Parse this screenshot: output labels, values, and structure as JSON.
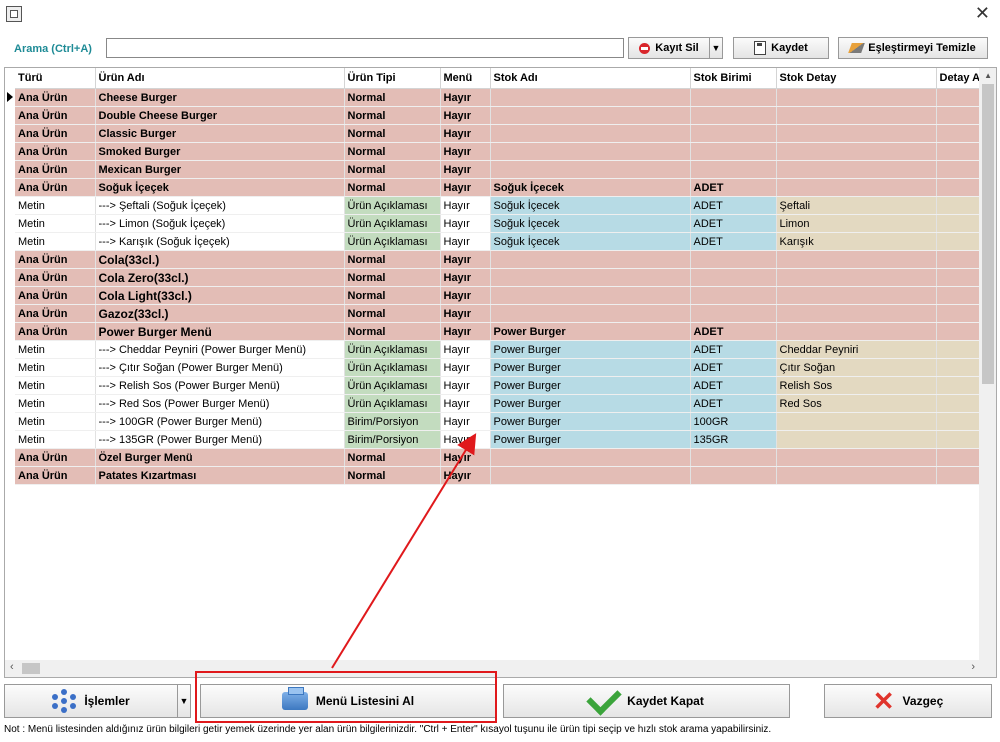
{
  "window": {
    "close_glyph": "✕"
  },
  "search": {
    "label": "Arama (Ctrl+A)",
    "value": "",
    "placeholder": ""
  },
  "toolbar": {
    "delete_label": "Kayıt Sil",
    "save_label": "Kaydet",
    "clear_label": "Eşleştirmeyi Temizle"
  },
  "grid": {
    "columns": [
      "Türü",
      "Ürün Adı",
      "Ürün Tipi",
      "Menü",
      "Stok Adı",
      "Stok Birimi",
      "Stok Detay",
      "Detay A"
    ],
    "rows": [
      {
        "kind": "ana",
        "turu": "Ana Ürün",
        "urun": "Cheese Burger",
        "tip": "Normal",
        "menu": "Hayır",
        "stok": "",
        "birim": "",
        "detay": ""
      },
      {
        "kind": "ana",
        "turu": "Ana Ürün",
        "urun": "Double Cheese Burger",
        "tip": "Normal",
        "menu": "Hayır",
        "stok": "",
        "birim": "",
        "detay": ""
      },
      {
        "kind": "ana",
        "turu": "Ana Ürün",
        "urun": "Classic Burger",
        "tip": "Normal",
        "menu": "Hayır",
        "stok": "",
        "birim": "",
        "detay": ""
      },
      {
        "kind": "ana",
        "turu": "Ana Ürün",
        "urun": "Smoked Burger",
        "tip": "Normal",
        "menu": "Hayır",
        "stok": "",
        "birim": "",
        "detay": ""
      },
      {
        "kind": "ana",
        "turu": "Ana Ürün",
        "urun": "Mexican Burger",
        "tip": "Normal",
        "menu": "Hayır",
        "stok": "",
        "birim": "",
        "detay": ""
      },
      {
        "kind": "ana",
        "turu": "Ana Ürün",
        "urun": "Soğuk İçeçek",
        "tip": "Normal",
        "menu": "Hayır",
        "stok": "Soğuk İçecek",
        "birim": "ADET",
        "detay": ""
      },
      {
        "kind": "metin",
        "turu": "Metin",
        "urun": "---> Şeftali (Soğuk İçeçek)",
        "tip": "Ürün Açıklaması",
        "menu": "Hayır",
        "stok": "Soğuk İçecek",
        "birim": "ADET",
        "detay": "Şeftali"
      },
      {
        "kind": "metin",
        "turu": "Metin",
        "urun": "---> Limon (Soğuk İçeçek)",
        "tip": "Ürün Açıklaması",
        "menu": "Hayır",
        "stok": "Soğuk İçecek",
        "birim": "ADET",
        "detay": "Limon"
      },
      {
        "kind": "metin",
        "turu": "Metin",
        "urun": "---> Karışık (Soğuk İçeçek)",
        "tip": "Ürün Açıklaması",
        "menu": "Hayır",
        "stok": "Soğuk İçecek",
        "birim": "ADET",
        "detay": "Karışık"
      },
      {
        "kind": "ana",
        "big": true,
        "turu": "Ana Ürün",
        "urun": "Cola(33cl.)",
        "tip": "Normal",
        "menu": "Hayır",
        "stok": "",
        "birim": "",
        "detay": ""
      },
      {
        "kind": "ana",
        "big": true,
        "turu": "Ana Ürün",
        "urun": "Cola Zero(33cl.)",
        "tip": "Normal",
        "menu": "Hayır",
        "stok": "",
        "birim": "",
        "detay": ""
      },
      {
        "kind": "ana",
        "big": true,
        "turu": "Ana Ürün",
        "urun": "Cola Light(33cl.)",
        "tip": "Normal",
        "menu": "Hayır",
        "stok": "",
        "birim": "",
        "detay": ""
      },
      {
        "kind": "ana",
        "big": true,
        "turu": "Ana Ürün",
        "urun": "Gazoz(33cl.)",
        "tip": "Normal",
        "menu": "Hayır",
        "stok": "",
        "birim": "",
        "detay": ""
      },
      {
        "kind": "ana",
        "big": true,
        "turu": "Ana Ürün",
        "urun": "Power Burger Menü",
        "tip": "Normal",
        "menu": "Hayır",
        "stok": "Power Burger",
        "birim": "ADET",
        "detay": ""
      },
      {
        "kind": "metin",
        "turu": "Metin",
        "urun": "---> Cheddar Peyniri (Power Burger Menü)",
        "tip": "Ürün Açıklaması",
        "menu": "Hayır",
        "stok": "Power Burger",
        "birim": "ADET",
        "detay": "Cheddar Peyniri"
      },
      {
        "kind": "metin",
        "turu": "Metin",
        "urun": "---> Çıtır Soğan (Power Burger Menü)",
        "tip": "Ürün Açıklaması",
        "menu": "Hayır",
        "stok": "Power Burger",
        "birim": "ADET",
        "detay": "Çıtır Soğan"
      },
      {
        "kind": "metin",
        "turu": "Metin",
        "urun": "---> Relish Sos (Power Burger Menü)",
        "tip": "Ürün Açıklaması",
        "menu": "Hayır",
        "stok": "Power Burger",
        "birim": "ADET",
        "detay": "Relish Sos"
      },
      {
        "kind": "metin",
        "turu": "Metin",
        "urun": "---> Red Sos (Power Burger Menü)",
        "tip": "Ürün Açıklaması",
        "menu": "Hayır",
        "stok": "Power Burger",
        "birim": "ADET",
        "detay": "Red Sos"
      },
      {
        "kind": "metin",
        "turu": "Metin",
        "urun": "---> 100GR (Power Burger Menü)",
        "tip": "Birim/Porsiyon",
        "menu": "Hayır",
        "stok": "Power Burger",
        "birim": "100GR",
        "detay": ""
      },
      {
        "kind": "metin",
        "turu": "Metin",
        "urun": "---> 135GR (Power Burger Menü)",
        "tip": "Birim/Porsiyon",
        "menu": "Hayır",
        "stok": "Power Burger",
        "birim": "135GR",
        "detay": ""
      },
      {
        "kind": "ana",
        "turu": "Ana Ürün",
        "urun": "Özel Burger Menü",
        "tip": "Normal",
        "menu": "Hayır",
        "stok": "",
        "birim": "",
        "detay": ""
      },
      {
        "kind": "ana",
        "turu": "Ana Ürün",
        "urun": "Patates Kızartması",
        "tip": "Normal",
        "menu": "Hayır",
        "stok": "",
        "birim": "",
        "detay": ""
      }
    ]
  },
  "bottom": {
    "islemler_label": "İşlemler",
    "menu_list_label": "Menü Listesini Al",
    "save_close_label": "Kaydet Kapat",
    "cancel_label": "Vazgeç"
  },
  "note": "Not :  Menü listesinden aldığınız ürün bilgileri getir yemek üzerinde yer alan ürün bilgilerinizdir.  \"Ctrl + Enter\" kısayol tuşunu ile ürün tipi seçip ve hızlı stok arama yapabilirsiniz.",
  "colors": {
    "ana_row": "#e3bdb6",
    "tip_cell": "#c3dcbf",
    "stok_cell": "#b7dbe5",
    "detay_cell": "#e3d9c1",
    "highlight": "#e0191c",
    "label_teal": "#1e8b96"
  }
}
